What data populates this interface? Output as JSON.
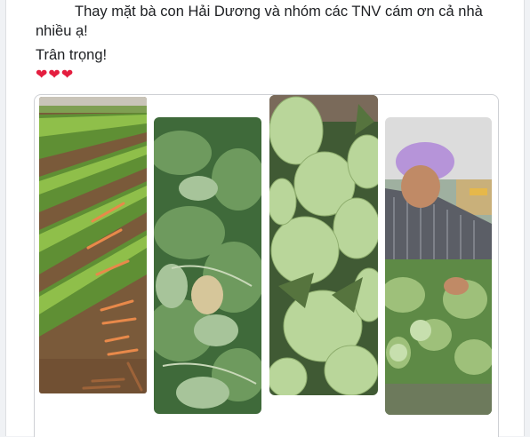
{
  "post": {
    "line1": "Thay mặt bà con Hải Dương và nhóm các TNV cám ơn cả nhà",
    "line2": "nhiều ạ!",
    "closing": "Trân trọng!",
    "hearts": "❤❤❤"
  },
  "photos": [
    {
      "name": "carrot-field-photo"
    },
    {
      "name": "guava-leaves-photo"
    },
    {
      "name": "guava-fruits-photo"
    },
    {
      "name": "farmer-woman-photo"
    }
  ],
  "colors": {
    "page_bg": "#f0f2f5",
    "card_bg": "#ffffff",
    "text": "#1c1e21",
    "heart": "#e41e3f"
  }
}
